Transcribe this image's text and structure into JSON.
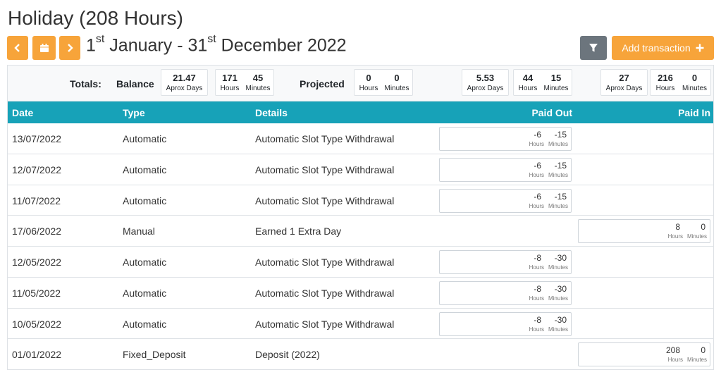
{
  "page": {
    "title": "Holiday (208 Hours)",
    "date_range": {
      "start_day": "1",
      "start_sup": "st",
      "start_rest": " January - 31",
      "end_sup": "st",
      "end_rest": " December 2022"
    }
  },
  "toolbar": {
    "add_label": "Add transaction",
    "icons": {
      "prev": "chevron-left-icon",
      "calendar": "calendar-icon",
      "next": "chevron-right-icon",
      "filter": "filter-icon",
      "add": "plus-icon"
    }
  },
  "totals": {
    "label": "Totals:",
    "balance_label": "Balance",
    "projected_label": "Projected",
    "balance": {
      "days": "21.47",
      "days_unit": "Aprox Days",
      "hours": "171",
      "minutes": "45"
    },
    "projected": {
      "hours": "0",
      "minutes": "0"
    },
    "group2": {
      "days": "5.53",
      "days_unit": "Aprox Days",
      "hours": "44",
      "minutes": "15"
    },
    "group3": {
      "days": "27",
      "days_unit": "Aprox Days",
      "hours": "216",
      "minutes": "0"
    },
    "hours_unit": "Hours",
    "minutes_unit": "Minutes"
  },
  "table": {
    "headers": {
      "date": "Date",
      "type": "Type",
      "details": "Details",
      "paid_out": "Paid Out",
      "paid_in": "Paid In"
    },
    "rows": [
      {
        "date": "13/07/2022",
        "type": "Automatic",
        "details": "Automatic Slot Type Withdrawal",
        "out_hours": "-6",
        "out_minutes": "-15",
        "in_hours": "",
        "in_minutes": ""
      },
      {
        "date": "12/07/2022",
        "type": "Automatic",
        "details": "Automatic Slot Type Withdrawal",
        "out_hours": "-6",
        "out_minutes": "-15",
        "in_hours": "",
        "in_minutes": ""
      },
      {
        "date": "11/07/2022",
        "type": "Automatic",
        "details": "Automatic Slot Type Withdrawal",
        "out_hours": "-6",
        "out_minutes": "-15",
        "in_hours": "",
        "in_minutes": ""
      },
      {
        "date": "17/06/2022",
        "type": "Manual",
        "details": "Earned 1 Extra Day",
        "out_hours": "",
        "out_minutes": "",
        "in_hours": "8",
        "in_minutes": "0"
      },
      {
        "date": "12/05/2022",
        "type": "Automatic",
        "details": "Automatic Slot Type Withdrawal",
        "out_hours": "-8",
        "out_minutes": "-30",
        "in_hours": "",
        "in_minutes": ""
      },
      {
        "date": "11/05/2022",
        "type": "Automatic",
        "details": "Automatic Slot Type Withdrawal",
        "out_hours": "-8",
        "out_minutes": "-30",
        "in_hours": "",
        "in_minutes": ""
      },
      {
        "date": "10/05/2022",
        "type": "Automatic",
        "details": "Automatic Slot Type Withdrawal",
        "out_hours": "-8",
        "out_minutes": "-30",
        "in_hours": "",
        "in_minutes": ""
      },
      {
        "date": "01/01/2022",
        "type": "Fixed_Deposit",
        "details": "Deposit (2022)",
        "out_hours": "",
        "out_minutes": "",
        "in_hours": "208",
        "in_minutes": "0"
      }
    ]
  },
  "colors": {
    "accent": "#f7a43a",
    "header": "#17a2b8",
    "filter": "#6c757d"
  }
}
